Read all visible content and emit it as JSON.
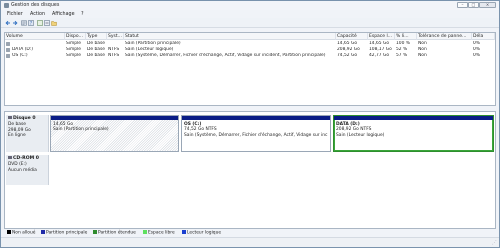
{
  "window": {
    "title": "Gestion des disques"
  },
  "menu": [
    "Fichier",
    "Action",
    "Affichage",
    "?"
  ],
  "table": {
    "columns": [
      "Volume",
      "Dispo...",
      "Type",
      "Syst...",
      "Statut",
      "Capacité",
      "Espace l...",
      "% li...",
      "Tolérance de panne...",
      "Déla"
    ],
    "rows": [
      [
        "",
        "Simple",
        "De base",
        "",
        "Sain (Partition principale)",
        "14,65 Go",
        "14,65 Go",
        "100 %",
        "Non",
        "0%"
      ],
      [
        "DATA (D:)",
        "Simple",
        "De base",
        "NTFS",
        "Sain (Lecteur logique)",
        "208,92 Go",
        "108,17 Go",
        "52 %",
        "Non",
        "0%"
      ],
      [
        "OS (C:)",
        "Simple",
        "De base",
        "NTFS",
        "Sain (Système, Démarrer, Fichier d'échange, Actif, Vidage sur incident, Partition principale)",
        "74,52 Go",
        "42,77 Go",
        "57 %",
        "Non",
        "0%"
      ]
    ]
  },
  "disks": [
    {
      "title": "Disque 0",
      "lines": [
        "De base",
        "298,09 Go",
        "En ligne"
      ],
      "partitions": [
        {
          "name": "",
          "size": "14,65 Go",
          "status": "Sain (Partition principale)",
          "bar_color": "#0a1d86",
          "hatched": true,
          "selected": false
        },
        {
          "name": "OS (C:)",
          "size": "74,52 Go NTFS",
          "status": "Sain (Système, Démarrer, Fichier d'échange, Actif, Vidage sur inc",
          "bar_color": "#0a1d86",
          "hatched": false,
          "selected": false
        },
        {
          "name": "DATA (D:)",
          "size": "208,92 Go NTFS",
          "status": "Sain (Lecteur logique)",
          "bar_color": "#0a1d86",
          "hatched": false,
          "selected": true
        }
      ]
    },
    {
      "title": "CD-ROM 0",
      "lines": [
        "DVD (E:)",
        "",
        "Aucun média"
      ]
    }
  ],
  "legend": [
    {
      "label": "Non alloué",
      "color": "#000000"
    },
    {
      "label": "Partition principale",
      "color": "#1f2aa8"
    },
    {
      "label": "Partition étendue",
      "color": "#2e8b2e"
    },
    {
      "label": "Espace libre",
      "color": "#5fe05f"
    },
    {
      "label": "Lecteur logique",
      "color": "#1a3fd0"
    }
  ],
  "toolbar_icons": [
    "back-arrow-icon",
    "forward-arrow-icon",
    "properties-icon",
    "help-icon",
    "refresh-icon",
    "settings-icon",
    "folder-icon"
  ]
}
